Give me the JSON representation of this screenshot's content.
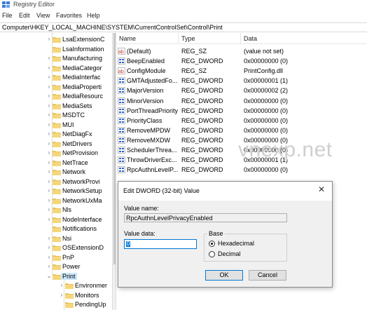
{
  "window": {
    "title": "Registry Editor"
  },
  "menu": [
    "File",
    "Edit",
    "View",
    "Favorites",
    "Help"
  ],
  "address": "Computer\\HKEY_LOCAL_MACHINE\\SYSTEM\\CurrentControlSet\\Control\\Print",
  "tree": [
    {
      "label": "LsaExtensionC",
      "depth": 0,
      "expander": true
    },
    {
      "label": "LsaInformation",
      "depth": 0,
      "expander": false
    },
    {
      "label": "Manufacturing",
      "depth": 0,
      "expander": true
    },
    {
      "label": "MediaCategor",
      "depth": 0,
      "expander": true
    },
    {
      "label": "MediaInterfac",
      "depth": 0,
      "expander": true
    },
    {
      "label": "MediaProperti",
      "depth": 0,
      "expander": true
    },
    {
      "label": "MediaResourc",
      "depth": 0,
      "expander": true
    },
    {
      "label": "MediaSets",
      "depth": 0,
      "expander": true
    },
    {
      "label": "MSDTC",
      "depth": 0,
      "expander": true
    },
    {
      "label": "MUI",
      "depth": 0,
      "expander": true
    },
    {
      "label": "NetDiagFx",
      "depth": 0,
      "expander": true
    },
    {
      "label": "NetDrivers",
      "depth": 0,
      "expander": true
    },
    {
      "label": "NetProvision",
      "depth": 0,
      "expander": true
    },
    {
      "label": "NetTrace",
      "depth": 0,
      "expander": true
    },
    {
      "label": "Network",
      "depth": 0,
      "expander": true
    },
    {
      "label": "NetworkProvi",
      "depth": 0,
      "expander": true
    },
    {
      "label": "NetworkSetup",
      "depth": 0,
      "expander": true
    },
    {
      "label": "NetworkUxMa",
      "depth": 0,
      "expander": true
    },
    {
      "label": "Nls",
      "depth": 0,
      "expander": true
    },
    {
      "label": "NodeInterface",
      "depth": 0,
      "expander": true
    },
    {
      "label": "Notifications",
      "depth": 0,
      "expander": false
    },
    {
      "label": "Nsi",
      "depth": 0,
      "expander": true
    },
    {
      "label": "OSExtensionD",
      "depth": 0,
      "expander": true
    },
    {
      "label": "PnP",
      "depth": 0,
      "expander": true
    },
    {
      "label": "Power",
      "depth": 0,
      "expander": true
    },
    {
      "label": "Print",
      "depth": 0,
      "expander": true,
      "expanded": true,
      "selected": true
    },
    {
      "label": "Environmer",
      "depth": 1,
      "expander": true
    },
    {
      "label": "Monitors",
      "depth": 1,
      "expander": true
    },
    {
      "label": "PendingUp",
      "depth": 1,
      "expander": false
    }
  ],
  "columns": {
    "name": "Name",
    "type": "Type",
    "data": "Data"
  },
  "values": [
    {
      "icon": "string",
      "name": "(Default)",
      "type": "REG_SZ",
      "data": "(value not set)"
    },
    {
      "icon": "binary",
      "name": "BeepEnabled",
      "type": "REG_DWORD",
      "data": "0x00000000 (0)"
    },
    {
      "icon": "string",
      "name": "ConfigModule",
      "type": "REG_SZ",
      "data": "PrintConfig.dll"
    },
    {
      "icon": "binary",
      "name": "GMTAdjustedFo...",
      "type": "REG_DWORD",
      "data": "0x00000001 (1)"
    },
    {
      "icon": "binary",
      "name": "MajorVersion",
      "type": "REG_DWORD",
      "data": "0x00000002 (2)"
    },
    {
      "icon": "binary",
      "name": "MinorVersion",
      "type": "REG_DWORD",
      "data": "0x00000000 (0)"
    },
    {
      "icon": "binary",
      "name": "PortThreadPriority",
      "type": "REG_DWORD",
      "data": "0x00000000 (0)"
    },
    {
      "icon": "binary",
      "name": "PriorityClass",
      "type": "REG_DWORD",
      "data": "0x00000000 (0)"
    },
    {
      "icon": "binary",
      "name": "RemoveMPDW",
      "type": "REG_DWORD",
      "data": "0x00000000 (0)"
    },
    {
      "icon": "binary",
      "name": "RemoveMXDW",
      "type": "REG_DWORD",
      "data": "0x00000000 (0)"
    },
    {
      "icon": "binary",
      "name": "SchedulerThrea...",
      "type": "REG_DWORD",
      "data": "0x00000000 (0)"
    },
    {
      "icon": "binary",
      "name": "ThrowDriverExc...",
      "type": "REG_DWORD",
      "data": "0x00000001 (1)"
    },
    {
      "icon": "binary",
      "name": "RpcAuthnLevelP...",
      "type": "REG_DWORD",
      "data": "0x00000000 (0)"
    }
  ],
  "watermark": "vnexp.net",
  "dialog": {
    "title": "Edit DWORD (32-bit) Value",
    "close_glyph": "✕",
    "value_name_label": "Value name:",
    "value_name": "RpcAuthnLevelPrivacyEnabled",
    "value_data_label": "Value data:",
    "value_data": "0",
    "base_label": "Base",
    "hex_label": "Hexadecimal",
    "dec_label": "Decimal",
    "base_selected": "Hexadecimal",
    "ok_label": "OK",
    "cancel_label": "Cancel"
  },
  "colors": {
    "folder": "#e8c25d",
    "selection": "#cce8ff",
    "accent": "#0078d7",
    "string_icon": "#c0392b",
    "binary_icon": "#2b63c9"
  }
}
